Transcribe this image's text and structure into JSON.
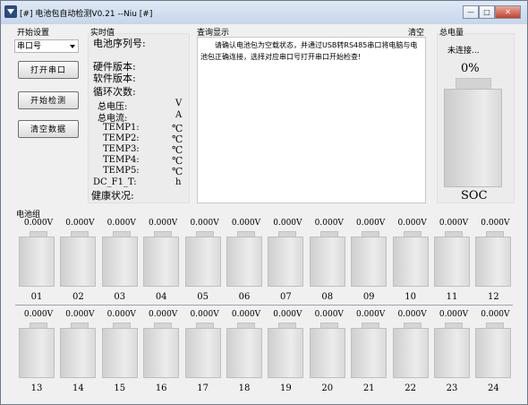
{
  "window": {
    "title": "[#] 电池包自动检测V0.21 --Niu [#]",
    "controls": [
      "—",
      "□",
      "✕"
    ]
  },
  "start_settings": {
    "label": "开始设置",
    "port_combo": "串口号",
    "open_port": "打开串口",
    "start_test": "开始检测",
    "clear_data": "清空数据"
  },
  "realtime": {
    "label": "实时值",
    "serial": "电池序列号:",
    "hw": "硬件版本:",
    "sw": "软件版本:",
    "cycles": "循环次数:",
    "voltage": "总电压:",
    "voltage_unit": "V",
    "current": "总电流:",
    "current_unit": "A",
    "t1": "TEMP1:",
    "t2": "TEMP2:",
    "t3": "TEMP3:",
    "t4": "TEMP4:",
    "t5": "TEMP5:",
    "t_unit": "℃",
    "dcf": "DC_F1_T:",
    "dcf_unit": "h",
    "health": "健康状况:"
  },
  "query": {
    "label": "查询显示",
    "clear": "清空",
    "message": "请确认电池包为空载状态，并通过USB转RS485串口将电脑与电池包正确连接，选择对应串口号打开串口开始检查!"
  },
  "capacity": {
    "label": "总电量",
    "status": "未连接...",
    "percent": "0%",
    "soc": "SOC"
  },
  "cells": {
    "label": "电池组",
    "row1": [
      {
        "v": "0.000V",
        "n": "01"
      },
      {
        "v": "0.000V",
        "n": "02"
      },
      {
        "v": "0.000V",
        "n": "03"
      },
      {
        "v": "0.000V",
        "n": "04"
      },
      {
        "v": "0.000V",
        "n": "05"
      },
      {
        "v": "0.000V",
        "n": "06"
      },
      {
        "v": "0.000V",
        "n": "07"
      },
      {
        "v": "0.000V",
        "n": "08"
      },
      {
        "v": "0.000V",
        "n": "09"
      },
      {
        "v": "0.000V",
        "n": "10"
      },
      {
        "v": "0.000V",
        "n": "11"
      },
      {
        "v": "0.000V",
        "n": "12"
      }
    ],
    "row2": [
      {
        "v": "0.000V",
        "n": "13"
      },
      {
        "v": "0.000V",
        "n": "14"
      },
      {
        "v": "0.000V",
        "n": "15"
      },
      {
        "v": "0.000V",
        "n": "16"
      },
      {
        "v": "0.000V",
        "n": "17"
      },
      {
        "v": "0.000V",
        "n": "18"
      },
      {
        "v": "0.000V",
        "n": "19"
      },
      {
        "v": "0.000V",
        "n": "20"
      },
      {
        "v": "0.000V",
        "n": "21"
      },
      {
        "v": "0.000V",
        "n": "22"
      },
      {
        "v": "0.000V",
        "n": "23"
      },
      {
        "v": "0.000V",
        "n": "24"
      }
    ]
  }
}
